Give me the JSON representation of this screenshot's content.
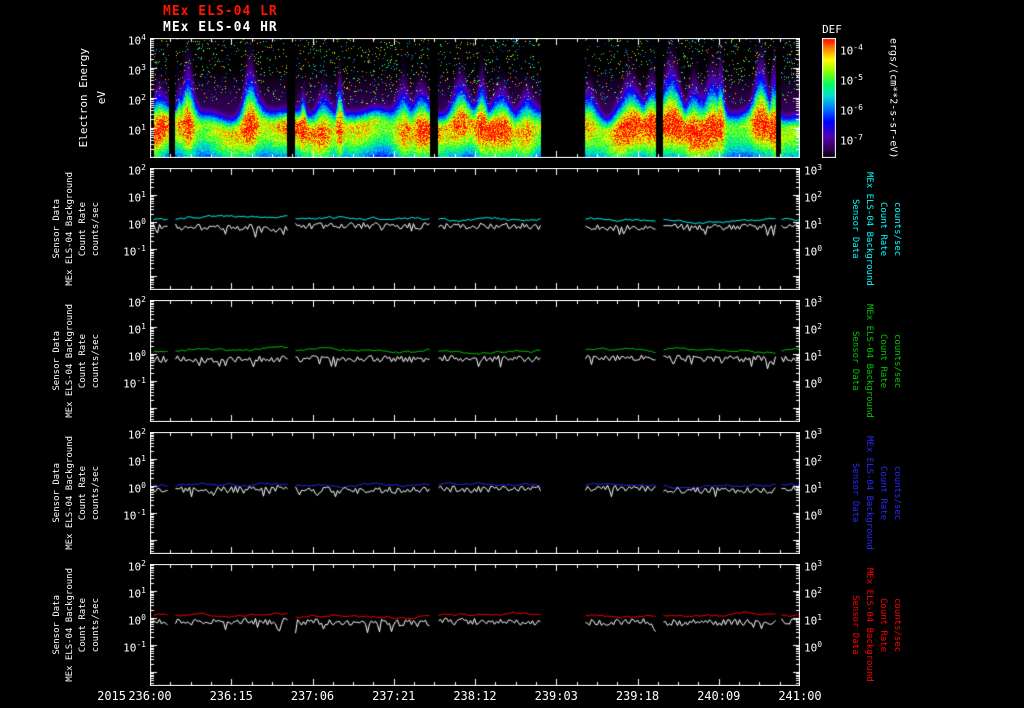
{
  "header": {
    "title_lr": "MEx ELS-04 LR",
    "title_hr": "MEx ELS-04 HR",
    "title_lr_color": "#ff1400",
    "title_hr_color": "#ffffff"
  },
  "time_axis": {
    "year_label": "2015",
    "tick_labels": [
      "236:00",
      "236:15",
      "237:06",
      "237:21",
      "238:12",
      "239:03",
      "239:18",
      "240:09",
      "241:00"
    ]
  },
  "segments_frac": [
    [
      0.005,
      0.028
    ],
    [
      0.038,
      0.21
    ],
    [
      0.223,
      0.43
    ],
    [
      0.443,
      0.6
    ],
    [
      0.669,
      0.777
    ],
    [
      0.789,
      0.962
    ],
    [
      0.97,
      1.0
    ]
  ],
  "chart_data": [
    {
      "type": "heatmap",
      "name": "electron-energy-spectrogram",
      "ylabel": "Electron Energy",
      "yunit": "eV",
      "ytick_exponents": [
        4,
        3,
        2,
        1
      ],
      "yrange_exponents": [
        0,
        4
      ],
      "bright_band_energy_ev": [
        5,
        50
      ],
      "colorbar": {
        "title": "DEF",
        "unit": "ergs/(cm**2-s-sr-eV)",
        "tick_exponents": [
          -4,
          -5,
          -6,
          -7
        ]
      }
    },
    {
      "type": "line",
      "name": "els04-background-panel-1",
      "left_label_lines": [
        "Sensor Data",
        "MEx ELS-04 Background",
        "Count Rate",
        "counts/sec"
      ],
      "right_label_lines": [
        "Sensor Data",
        "MEx ELS-04 Background",
        "Count Rate",
        "counts/sec"
      ],
      "accent_color": "#00ffff",
      "left_tick_exponents": [
        2,
        1,
        0,
        -1
      ],
      "right_tick_exponents": [
        3,
        2,
        1,
        0
      ],
      "series": [
        {
          "name": "background rate",
          "color": "#00ffff",
          "approx_level": 1.3
        },
        {
          "name": "count rate",
          "color": "#ffffff",
          "approx_level": 0.72
        }
      ]
    },
    {
      "type": "line",
      "name": "els04-background-panel-2",
      "left_label_lines": [
        "Sensor Data",
        "MEx ELS-04 Background",
        "Count Rate",
        "counts/sec"
      ],
      "right_label_lines": [
        "Sensor Data",
        "MEx ELS-04 Background",
        "Count Rate",
        "counts/sec"
      ],
      "accent_color": "#00c800",
      "left_tick_exponents": [
        2,
        1,
        0,
        -1
      ],
      "right_tick_exponents": [
        3,
        2,
        1,
        0
      ],
      "series": [
        {
          "name": "background rate",
          "color": "#00c800",
          "approx_level": 1.35
        },
        {
          "name": "count rate",
          "color": "#ffffff",
          "approx_level": 0.7
        }
      ]
    },
    {
      "type": "line",
      "name": "els04-background-panel-3",
      "left_label_lines": [
        "Sensor Data",
        "MEx ELS-04 Background",
        "Count Rate",
        "counts/sec"
      ],
      "right_label_lines": [
        "Sensor Data",
        "MEx ELS-04 Background",
        "Count Rate",
        "counts/sec"
      ],
      "accent_color": "#2828ff",
      "left_tick_exponents": [
        2,
        1,
        0,
        -1
      ],
      "right_tick_exponents": [
        3,
        2,
        1,
        0
      ],
      "series": [
        {
          "name": "background rate",
          "color": "#2828ff",
          "approx_level": 1.05
        },
        {
          "name": "count rate",
          "color": "#ffffff",
          "approx_level": 0.8
        }
      ]
    },
    {
      "type": "line",
      "name": "els04-background-panel-4",
      "left_label_lines": [
        "Sensor Data",
        "MEx ELS-04 Background",
        "Count Rate",
        "counts/sec"
      ],
      "right_label_lines": [
        "Sensor Data",
        "MEx ELS-04 Background",
        "Count Rate",
        "counts/sec"
      ],
      "accent_color": "#ff0000",
      "left_tick_exponents": [
        2,
        1,
        0,
        -1
      ],
      "right_tick_exponents": [
        3,
        2,
        1,
        0
      ],
      "series": [
        {
          "name": "background rate",
          "color": "#ff0000",
          "approx_level": 1.25
        },
        {
          "name": "count rate",
          "color": "#ffffff",
          "approx_level": 0.75
        }
      ]
    }
  ]
}
